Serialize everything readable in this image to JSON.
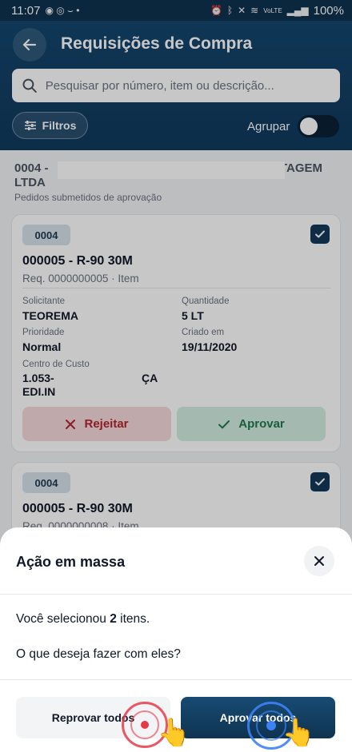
{
  "status_bar": {
    "time": "11:07",
    "battery": "100%",
    "network": "VoLTE"
  },
  "header": {
    "title": "Requisições de Compra",
    "search_placeholder": "Pesquisar por número, item ou descrição...",
    "filter_label": "Filtros",
    "group_label": "Agrupar",
    "group_enabled": false
  },
  "group": {
    "title_prefix": "0004 -",
    "title_suffix": "ETAGEM",
    "title_line2": "LTDA",
    "subtitle": "Pedidos submetidos de aprovação"
  },
  "cards": [
    {
      "code": "0004",
      "title": "000005 - R-90 30M",
      "req": "Req. 0000000005 · Item",
      "selected": true,
      "requester_label": "Solicitante",
      "requester": "TEOREMA",
      "quantity_label": "Quantidade",
      "quantity": "5 LT",
      "priority_label": "Prioridade",
      "priority": "Normal",
      "created_label": "Criado em",
      "created": "19/11/2020",
      "cost_center_label": "Centro de Custo",
      "cost_center_line1_a": "1.053-",
      "cost_center_line1_b": "ÇA",
      "cost_center_line2": "EDI.IN",
      "reject_label": "Rejeitar",
      "approve_label": "Aprovar"
    },
    {
      "code": "0004",
      "title": "000005 - R-90 30M",
      "req": "Req. 0000000008 · Item",
      "selected": true
    }
  ],
  "sheet": {
    "title": "Ação em massa",
    "selected_prefix": "Você selecionou",
    "selected_count": "2",
    "selected_suffix": "itens.",
    "question": "O que deseja fazer com eles?",
    "reprove_all": "Reprovar todos",
    "approve_all": "Aprovar todos"
  }
}
